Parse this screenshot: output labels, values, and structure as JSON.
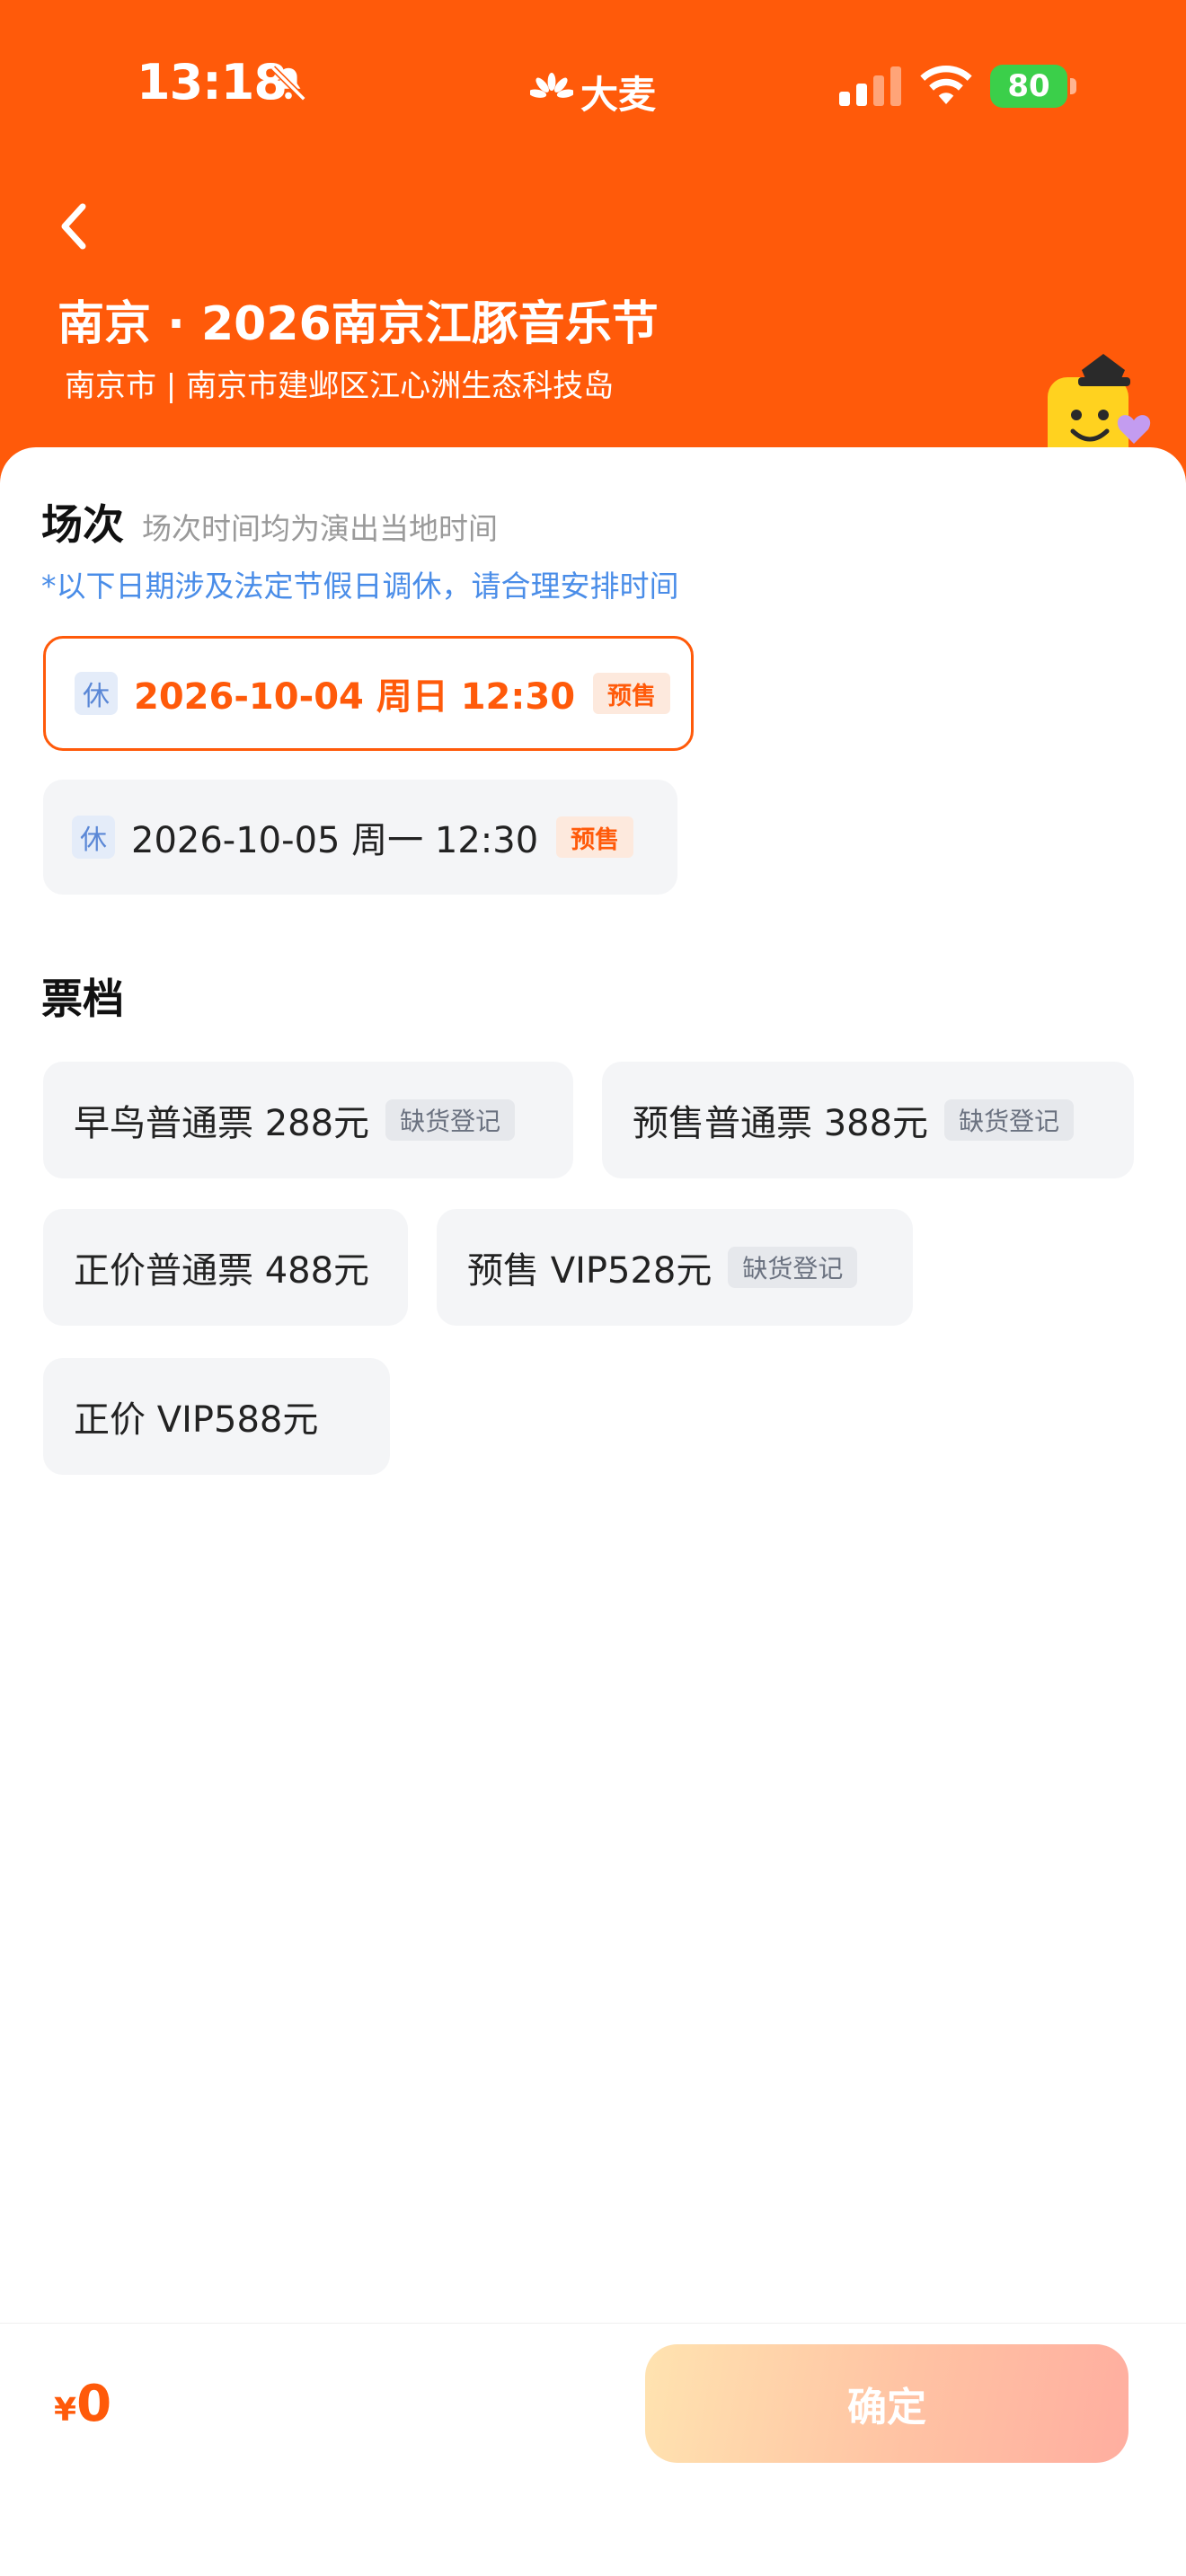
{
  "status_bar": {
    "time": "13:18",
    "brand": "大麦",
    "battery": "80"
  },
  "header": {
    "title": "南京 · 2026南京江豚音乐节",
    "venue": "南京市 | 南京市建邺区江心洲生态科技岛"
  },
  "sessions_section": {
    "title": "场次",
    "hint": "场次时间均为演出当地时间",
    "holiday_note": "*以下日期涉及法定节假日调休，请合理安排时间",
    "items": [
      {
        "rest_badge": "休",
        "label": "2026-10-04 周日 12:30",
        "tag": "预售",
        "selected": true
      },
      {
        "rest_badge": "休",
        "label": "2026-10-05 周一 12:30",
        "tag": "预售",
        "selected": false
      }
    ]
  },
  "tiers_section": {
    "title": "票档",
    "items": [
      {
        "label": "早鸟普通票 288元",
        "tag": "缺货登记"
      },
      {
        "label": "预售普通票 388元",
        "tag": "缺货登记"
      },
      {
        "label": "正价普通票 488元",
        "tag": ""
      },
      {
        "label": "预售 VIP528元",
        "tag": "缺货登记"
      },
      {
        "label": "正价 VIP588元",
        "tag": ""
      }
    ]
  },
  "footer": {
    "currency_symbol": "¥",
    "total": "0",
    "confirm_label": "确定"
  },
  "colors": {
    "brand_orange": "#ff5a0a",
    "link_blue": "#4a8de8",
    "battery_green": "#3bcf4a"
  },
  "icons": [
    "mute-bell-icon",
    "damai-logo-icon",
    "cellular-signal-icon",
    "wifi-icon",
    "battery-icon",
    "back-arrow-icon",
    "mascot-sticker"
  ]
}
